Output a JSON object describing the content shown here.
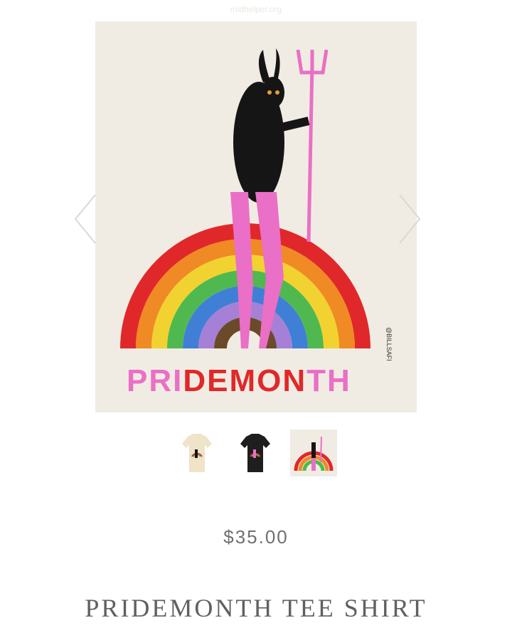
{
  "watermark": "midhelper.org",
  "product": {
    "price": "$35.00",
    "title": "PRIDEMONTH TEE SHIRT"
  },
  "artwork": {
    "headline_segments": [
      "PRI",
      "DEMON",
      "TH"
    ],
    "signature": "@BILLSAFI"
  },
  "thumbnails": [
    {
      "name": "cream-tee-thumbnail",
      "shirt_color": "#efe3c8"
    },
    {
      "name": "black-tee-thumbnail",
      "shirt_color": "#1e1e1e"
    },
    {
      "name": "art-print-thumbnail"
    }
  ],
  "icons": {
    "prev": "chevron-left-icon",
    "next": "chevron-right-icon"
  },
  "colors": {
    "pink": "#ea6fc6",
    "red": "#e0282a",
    "background": "#f1ece3",
    "text": "#606060"
  }
}
